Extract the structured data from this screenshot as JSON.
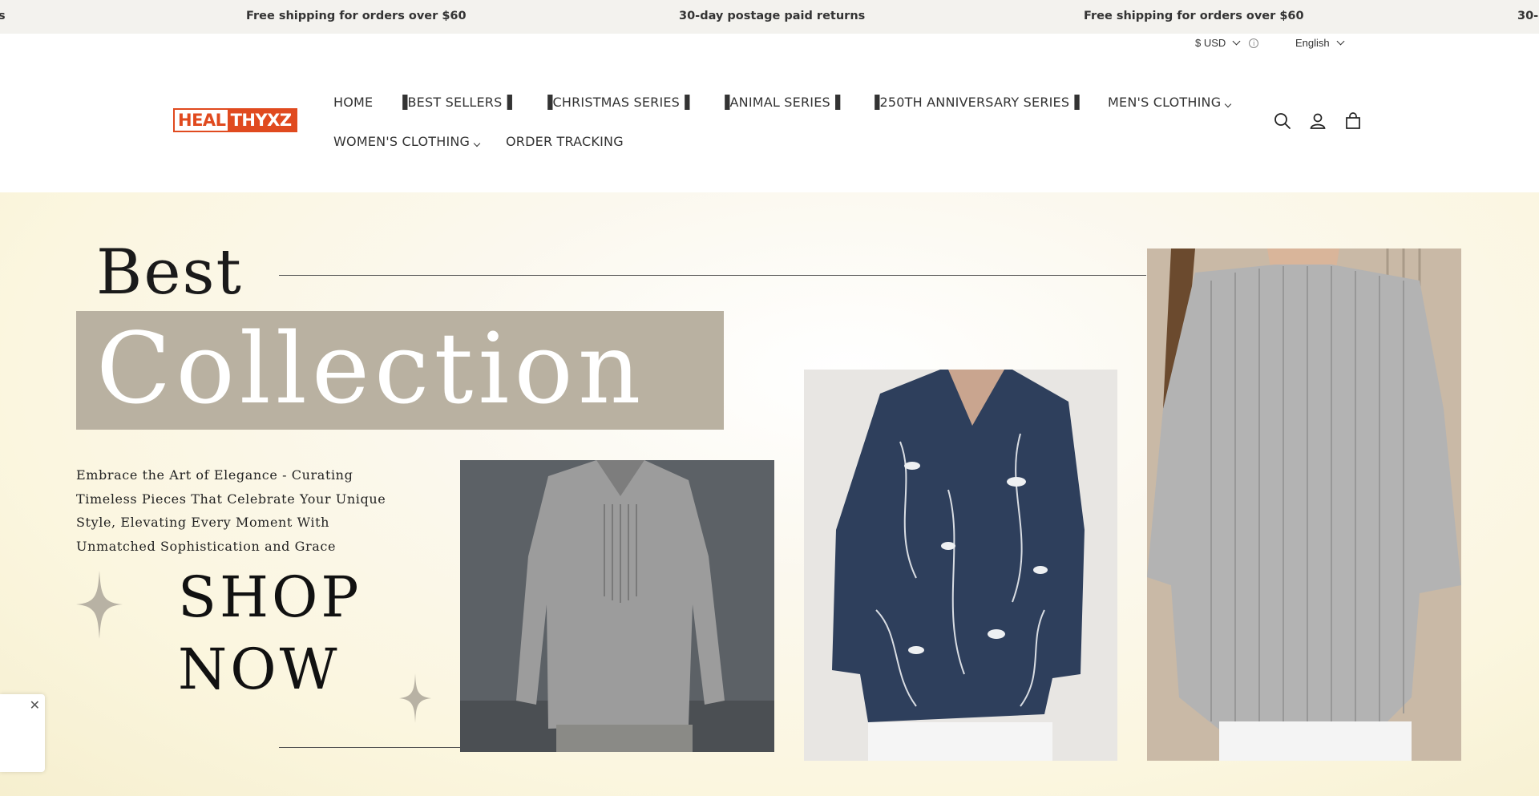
{
  "announcement": {
    "items": [
      "s",
      "Free shipping for orders over $60",
      "30-day postage paid returns",
      "Free shipping for orders over $60",
      "30-"
    ]
  },
  "utility": {
    "currency": "$ USD",
    "language": "English"
  },
  "header": {
    "logo": {
      "part1": "HEAL",
      "part2": "THYXZ"
    },
    "nav": [
      "HOME",
      "▐BEST SELLERS▐",
      "▐CHRISTMAS SERIES▐",
      "▐ANIMAL SERIES▐",
      "▐250TH ANNIVERSARY SERIES▐",
      "MEN'S CLOTHING",
      "WOMEN'S CLOTHING",
      "ORDER TRACKING"
    ],
    "icons": [
      "search-icon",
      "account-icon",
      "cart-icon"
    ]
  },
  "hero": {
    "title_top": "Best",
    "title_main": "Collection",
    "description": "Embrace the Art of Elegance - Curating Timeless Pieces That Celebrate Your Unique Style, Elevating Every Moment With Unmatched Sophistication and Grace",
    "cta_line1": "SHOP",
    "cta_line2": "NOW",
    "background": "#fbf6df",
    "box_color": "#b9b1a1"
  },
  "popup": {
    "close": "✕"
  },
  "colors": {
    "brand": "#e04a1f",
    "accent_star": "#b8b2a4"
  }
}
